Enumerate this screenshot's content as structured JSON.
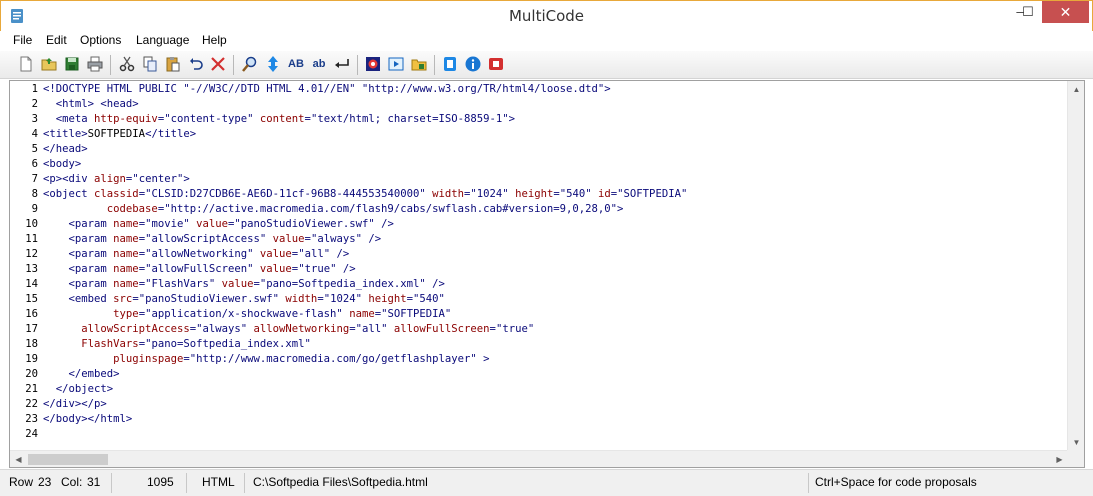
{
  "window": {
    "title": "MultiCode"
  },
  "title_controls": {
    "minimize": "–",
    "maximize": "☐",
    "close": "✕"
  },
  "menu": [
    "File",
    "Edit",
    "Options",
    "Language",
    "Help"
  ],
  "toolbar": {
    "find_case_label": "AB",
    "find_lower_label": "ab",
    "tools": [
      "new-file",
      "open-file",
      "save-file",
      "print",
      "cut",
      "copy",
      "paste",
      "undo",
      "delete",
      "find",
      "find-next",
      "match-case",
      "lowercase",
      "line-break",
      "run-browser",
      "preview",
      "open-folder",
      "bookmark",
      "info",
      "exit"
    ]
  },
  "editor": {
    "lines": [
      {
        "n": "1",
        "tokens": [
          [
            "tag",
            "<!DOCTYPE HTML PUBLIC "
          ],
          [
            "val",
            "\"-//W3C//DTD HTML 4.01//EN\" \"http://www.w3.org/TR/html4/loose.dtd\""
          ],
          [
            "tag",
            ">"
          ]
        ]
      },
      {
        "n": "2",
        "tokens": [
          [
            "tag",
            "  <html> <head>"
          ]
        ]
      },
      {
        "n": "3",
        "tokens": [
          [
            "tag",
            "  <meta "
          ],
          [
            "attr",
            "http-equiv"
          ],
          [
            "tag",
            "="
          ],
          [
            "val",
            "\"content-type\""
          ],
          [
            "tag",
            " "
          ],
          [
            "attr",
            "content"
          ],
          [
            "tag",
            "="
          ],
          [
            "val",
            "\"text/html; charset=ISO-8859-1\""
          ],
          [
            "tag",
            ">"
          ]
        ]
      },
      {
        "n": "4",
        "tokens": [
          [
            "tag",
            "<title>"
          ],
          [
            "txt",
            "SOFTPEDIA"
          ],
          [
            "tag",
            "</title>"
          ]
        ]
      },
      {
        "n": "5",
        "tokens": [
          [
            "tag",
            "</head>"
          ]
        ]
      },
      {
        "n": "6",
        "tokens": [
          [
            "tag",
            "<body>"
          ]
        ]
      },
      {
        "n": "7",
        "tokens": [
          [
            "tag",
            "<p><div "
          ],
          [
            "attr",
            "align"
          ],
          [
            "tag",
            "="
          ],
          [
            "val",
            "\"center\""
          ],
          [
            "tag",
            ">"
          ]
        ]
      },
      {
        "n": "8",
        "tokens": [
          [
            "tag",
            "<object "
          ],
          [
            "attr",
            "classid"
          ],
          [
            "tag",
            "="
          ],
          [
            "val",
            "\"CLSID:D27CDB6E-AE6D-11cf-96B8-444553540000\""
          ],
          [
            "tag",
            " "
          ],
          [
            "attr",
            "width"
          ],
          [
            "tag",
            "="
          ],
          [
            "val",
            "\"1024\""
          ],
          [
            "tag",
            " "
          ],
          [
            "attr",
            "height"
          ],
          [
            "tag",
            "="
          ],
          [
            "val",
            "\"540\""
          ],
          [
            "tag",
            " "
          ],
          [
            "attr",
            "id"
          ],
          [
            "tag",
            "="
          ],
          [
            "val",
            "\"SOFTPEDIA\""
          ]
        ]
      },
      {
        "n": "9",
        "tokens": [
          [
            "tag",
            "          "
          ],
          [
            "attr",
            "codebase"
          ],
          [
            "tag",
            "="
          ],
          [
            "val",
            "\"http://active.macromedia.com/flash9/cabs/swflash.cab#version=9,0,28,0\""
          ],
          [
            "tag",
            ">"
          ]
        ]
      },
      {
        "n": "10",
        "tokens": [
          [
            "tag",
            "    <param "
          ],
          [
            "attr",
            "name"
          ],
          [
            "tag",
            "="
          ],
          [
            "val",
            "\"movie\""
          ],
          [
            "tag",
            " "
          ],
          [
            "attr",
            "value"
          ],
          [
            "tag",
            "="
          ],
          [
            "val",
            "\"panoStudioViewer.swf\""
          ],
          [
            "tag",
            " />"
          ]
        ]
      },
      {
        "n": "11",
        "tokens": [
          [
            "tag",
            "    <param "
          ],
          [
            "attr",
            "name"
          ],
          [
            "tag",
            "="
          ],
          [
            "val",
            "\"allowScriptAccess\""
          ],
          [
            "tag",
            " "
          ],
          [
            "attr",
            "value"
          ],
          [
            "tag",
            "="
          ],
          [
            "val",
            "\"always\""
          ],
          [
            "tag",
            " />"
          ]
        ]
      },
      {
        "n": "12",
        "tokens": [
          [
            "tag",
            "    <param "
          ],
          [
            "attr",
            "name"
          ],
          [
            "tag",
            "="
          ],
          [
            "val",
            "\"allowNetworking\""
          ],
          [
            "tag",
            " "
          ],
          [
            "attr",
            "value"
          ],
          [
            "tag",
            "="
          ],
          [
            "val",
            "\"all\""
          ],
          [
            "tag",
            " />"
          ]
        ]
      },
      {
        "n": "13",
        "tokens": [
          [
            "tag",
            "    <param "
          ],
          [
            "attr",
            "name"
          ],
          [
            "tag",
            "="
          ],
          [
            "val",
            "\"allowFullScreen\""
          ],
          [
            "tag",
            " "
          ],
          [
            "attr",
            "value"
          ],
          [
            "tag",
            "="
          ],
          [
            "val",
            "\"true\""
          ],
          [
            "tag",
            " />"
          ]
        ]
      },
      {
        "n": "14",
        "tokens": [
          [
            "tag",
            "    <param "
          ],
          [
            "attr",
            "name"
          ],
          [
            "tag",
            "="
          ],
          [
            "val",
            "\"FlashVars\""
          ],
          [
            "tag",
            " "
          ],
          [
            "attr",
            "value"
          ],
          [
            "tag",
            "="
          ],
          [
            "val",
            "\"pano=Softpedia_index.xml\""
          ],
          [
            "tag",
            " />"
          ]
        ]
      },
      {
        "n": "15",
        "tokens": [
          [
            "tag",
            "    <embed "
          ],
          [
            "attr",
            "src"
          ],
          [
            "tag",
            "="
          ],
          [
            "val",
            "\"panoStudioViewer.swf\""
          ],
          [
            "tag",
            " "
          ],
          [
            "attr",
            "width"
          ],
          [
            "tag",
            "="
          ],
          [
            "val",
            "\"1024\""
          ],
          [
            "tag",
            " "
          ],
          [
            "attr",
            "height"
          ],
          [
            "tag",
            "="
          ],
          [
            "val",
            "\"540\""
          ]
        ]
      },
      {
        "n": "16",
        "tokens": [
          [
            "tag",
            "           "
          ],
          [
            "attr",
            "type"
          ],
          [
            "tag",
            "="
          ],
          [
            "val",
            "\"application/x-shockwave-flash\""
          ],
          [
            "tag",
            " "
          ],
          [
            "attr",
            "name"
          ],
          [
            "tag",
            "="
          ],
          [
            "val",
            "\"SOFTPEDIA\""
          ]
        ]
      },
      {
        "n": "17",
        "tokens": [
          [
            "tag",
            "      "
          ],
          [
            "attr",
            "allowScriptAccess"
          ],
          [
            "tag",
            "="
          ],
          [
            "val",
            "\"always\""
          ],
          [
            "tag",
            " "
          ],
          [
            "attr",
            "allowNetworking"
          ],
          [
            "tag",
            "="
          ],
          [
            "val",
            "\"all\""
          ],
          [
            "tag",
            " "
          ],
          [
            "attr",
            "allowFullScreen"
          ],
          [
            "tag",
            "="
          ],
          [
            "val",
            "\"true\""
          ]
        ]
      },
      {
        "n": "18",
        "tokens": [
          [
            "tag",
            "      "
          ],
          [
            "attr",
            "FlashVars"
          ],
          [
            "tag",
            "="
          ],
          [
            "val",
            "\"pano=Softpedia_index.xml\""
          ]
        ]
      },
      {
        "n": "19",
        "tokens": [
          [
            "tag",
            "           "
          ],
          [
            "attr",
            "pluginspage"
          ],
          [
            "tag",
            "="
          ],
          [
            "val",
            "\"http://www.macromedia.com/go/getflashplayer\""
          ],
          [
            "tag",
            " >"
          ]
        ]
      },
      {
        "n": "20",
        "tokens": [
          [
            "tag",
            "    </embed>"
          ]
        ]
      },
      {
        "n": "21",
        "tokens": [
          [
            "tag",
            "  </object>"
          ]
        ]
      },
      {
        "n": "22",
        "tokens": [
          [
            "tag",
            "</div></p>"
          ]
        ]
      },
      {
        "n": "23",
        "tokens": [
          [
            "tag",
            "</body></html>"
          ]
        ]
      },
      {
        "n": "24",
        "tokens": []
      }
    ]
  },
  "status": {
    "row_label": "Row",
    "row": "23",
    "col_label": "Col:",
    "col": "31",
    "length": "1095",
    "language": "HTML",
    "file_path": "C:\\Softpedia Files\\Softpedia.html",
    "hint": "Ctrl+Space for code proposals"
  },
  "colors": {
    "tag": "#0a0a7a",
    "attr": "#8b0000",
    "close_button": "#c75050",
    "title_border": "#e8a83a"
  }
}
